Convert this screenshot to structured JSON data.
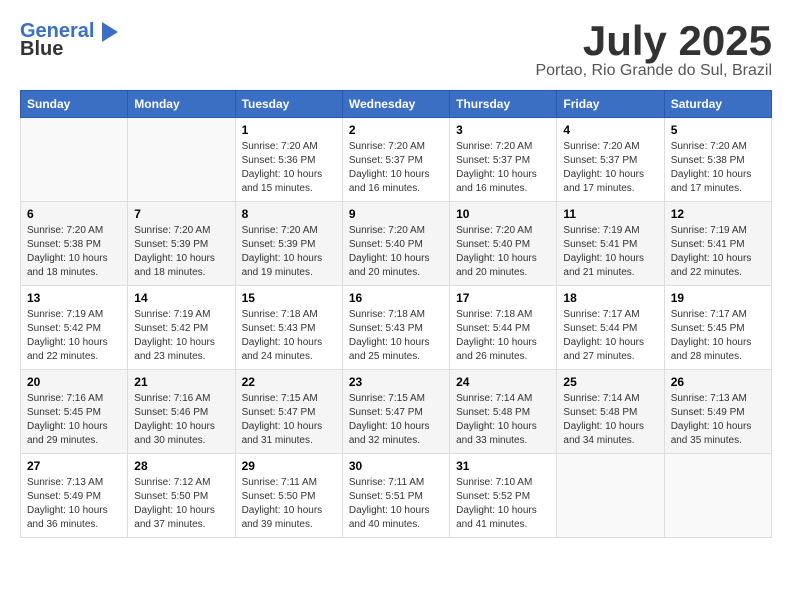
{
  "logo": {
    "line1": "General",
    "line2": "Blue"
  },
  "title": "July 2025",
  "location": "Portao, Rio Grande do Sul, Brazil",
  "headers": [
    "Sunday",
    "Monday",
    "Tuesday",
    "Wednesday",
    "Thursday",
    "Friday",
    "Saturday"
  ],
  "weeks": [
    [
      {
        "day": "",
        "sunrise": "",
        "sunset": "",
        "daylight": ""
      },
      {
        "day": "",
        "sunrise": "",
        "sunset": "",
        "daylight": ""
      },
      {
        "day": "1",
        "sunrise": "Sunrise: 7:20 AM",
        "sunset": "Sunset: 5:36 PM",
        "daylight": "Daylight: 10 hours and 15 minutes."
      },
      {
        "day": "2",
        "sunrise": "Sunrise: 7:20 AM",
        "sunset": "Sunset: 5:37 PM",
        "daylight": "Daylight: 10 hours and 16 minutes."
      },
      {
        "day": "3",
        "sunrise": "Sunrise: 7:20 AM",
        "sunset": "Sunset: 5:37 PM",
        "daylight": "Daylight: 10 hours and 16 minutes."
      },
      {
        "day": "4",
        "sunrise": "Sunrise: 7:20 AM",
        "sunset": "Sunset: 5:37 PM",
        "daylight": "Daylight: 10 hours and 17 minutes."
      },
      {
        "day": "5",
        "sunrise": "Sunrise: 7:20 AM",
        "sunset": "Sunset: 5:38 PM",
        "daylight": "Daylight: 10 hours and 17 minutes."
      }
    ],
    [
      {
        "day": "6",
        "sunrise": "Sunrise: 7:20 AM",
        "sunset": "Sunset: 5:38 PM",
        "daylight": "Daylight: 10 hours and 18 minutes."
      },
      {
        "day": "7",
        "sunrise": "Sunrise: 7:20 AM",
        "sunset": "Sunset: 5:39 PM",
        "daylight": "Daylight: 10 hours and 18 minutes."
      },
      {
        "day": "8",
        "sunrise": "Sunrise: 7:20 AM",
        "sunset": "Sunset: 5:39 PM",
        "daylight": "Daylight: 10 hours and 19 minutes."
      },
      {
        "day": "9",
        "sunrise": "Sunrise: 7:20 AM",
        "sunset": "Sunset: 5:40 PM",
        "daylight": "Daylight: 10 hours and 20 minutes."
      },
      {
        "day": "10",
        "sunrise": "Sunrise: 7:20 AM",
        "sunset": "Sunset: 5:40 PM",
        "daylight": "Daylight: 10 hours and 20 minutes."
      },
      {
        "day": "11",
        "sunrise": "Sunrise: 7:19 AM",
        "sunset": "Sunset: 5:41 PM",
        "daylight": "Daylight: 10 hours and 21 minutes."
      },
      {
        "day": "12",
        "sunrise": "Sunrise: 7:19 AM",
        "sunset": "Sunset: 5:41 PM",
        "daylight": "Daylight: 10 hours and 22 minutes."
      }
    ],
    [
      {
        "day": "13",
        "sunrise": "Sunrise: 7:19 AM",
        "sunset": "Sunset: 5:42 PM",
        "daylight": "Daylight: 10 hours and 22 minutes."
      },
      {
        "day": "14",
        "sunrise": "Sunrise: 7:19 AM",
        "sunset": "Sunset: 5:42 PM",
        "daylight": "Daylight: 10 hours and 23 minutes."
      },
      {
        "day": "15",
        "sunrise": "Sunrise: 7:18 AM",
        "sunset": "Sunset: 5:43 PM",
        "daylight": "Daylight: 10 hours and 24 minutes."
      },
      {
        "day": "16",
        "sunrise": "Sunrise: 7:18 AM",
        "sunset": "Sunset: 5:43 PM",
        "daylight": "Daylight: 10 hours and 25 minutes."
      },
      {
        "day": "17",
        "sunrise": "Sunrise: 7:18 AM",
        "sunset": "Sunset: 5:44 PM",
        "daylight": "Daylight: 10 hours and 26 minutes."
      },
      {
        "day": "18",
        "sunrise": "Sunrise: 7:17 AM",
        "sunset": "Sunset: 5:44 PM",
        "daylight": "Daylight: 10 hours and 27 minutes."
      },
      {
        "day": "19",
        "sunrise": "Sunrise: 7:17 AM",
        "sunset": "Sunset: 5:45 PM",
        "daylight": "Daylight: 10 hours and 28 minutes."
      }
    ],
    [
      {
        "day": "20",
        "sunrise": "Sunrise: 7:16 AM",
        "sunset": "Sunset: 5:45 PM",
        "daylight": "Daylight: 10 hours and 29 minutes."
      },
      {
        "day": "21",
        "sunrise": "Sunrise: 7:16 AM",
        "sunset": "Sunset: 5:46 PM",
        "daylight": "Daylight: 10 hours and 30 minutes."
      },
      {
        "day": "22",
        "sunrise": "Sunrise: 7:15 AM",
        "sunset": "Sunset: 5:47 PM",
        "daylight": "Daylight: 10 hours and 31 minutes."
      },
      {
        "day": "23",
        "sunrise": "Sunrise: 7:15 AM",
        "sunset": "Sunset: 5:47 PM",
        "daylight": "Daylight: 10 hours and 32 minutes."
      },
      {
        "day": "24",
        "sunrise": "Sunrise: 7:14 AM",
        "sunset": "Sunset: 5:48 PM",
        "daylight": "Daylight: 10 hours and 33 minutes."
      },
      {
        "day": "25",
        "sunrise": "Sunrise: 7:14 AM",
        "sunset": "Sunset: 5:48 PM",
        "daylight": "Daylight: 10 hours and 34 minutes."
      },
      {
        "day": "26",
        "sunrise": "Sunrise: 7:13 AM",
        "sunset": "Sunset: 5:49 PM",
        "daylight": "Daylight: 10 hours and 35 minutes."
      }
    ],
    [
      {
        "day": "27",
        "sunrise": "Sunrise: 7:13 AM",
        "sunset": "Sunset: 5:49 PM",
        "daylight": "Daylight: 10 hours and 36 minutes."
      },
      {
        "day": "28",
        "sunrise": "Sunrise: 7:12 AM",
        "sunset": "Sunset: 5:50 PM",
        "daylight": "Daylight: 10 hours and 37 minutes."
      },
      {
        "day": "29",
        "sunrise": "Sunrise: 7:11 AM",
        "sunset": "Sunset: 5:50 PM",
        "daylight": "Daylight: 10 hours and 39 minutes."
      },
      {
        "day": "30",
        "sunrise": "Sunrise: 7:11 AM",
        "sunset": "Sunset: 5:51 PM",
        "daylight": "Daylight: 10 hours and 40 minutes."
      },
      {
        "day": "31",
        "sunrise": "Sunrise: 7:10 AM",
        "sunset": "Sunset: 5:52 PM",
        "daylight": "Daylight: 10 hours and 41 minutes."
      },
      {
        "day": "",
        "sunrise": "",
        "sunset": "",
        "daylight": ""
      },
      {
        "day": "",
        "sunrise": "",
        "sunset": "",
        "daylight": ""
      }
    ]
  ]
}
